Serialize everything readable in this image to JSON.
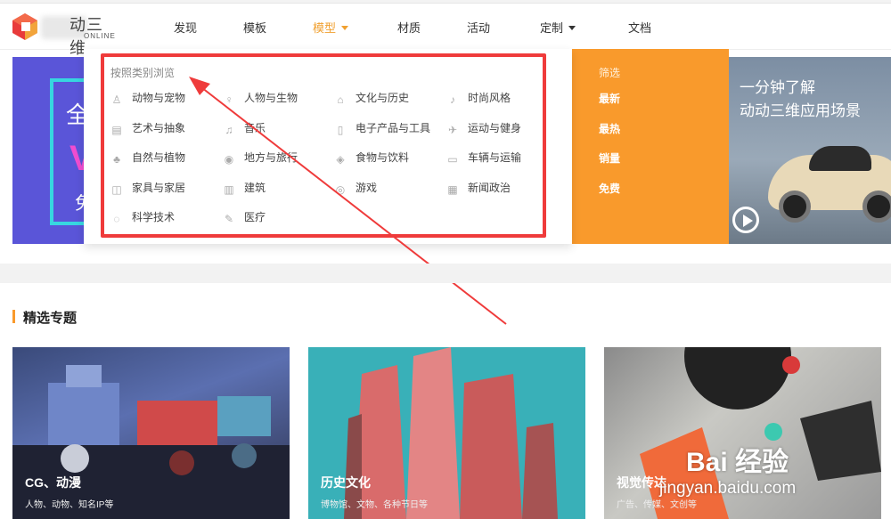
{
  "header": {
    "logo_text": "动三维",
    "logo_sub": "ONLINE",
    "nav": [
      {
        "label": "发现"
      },
      {
        "label": "模板"
      },
      {
        "label": "模型"
      },
      {
        "label": "材质"
      },
      {
        "label": "活动"
      },
      {
        "label": "定制"
      },
      {
        "label": "文档"
      }
    ],
    "accent_color": "#f0a030"
  },
  "hero_left": {
    "big": "全",
    "v": "V",
    "small": "免"
  },
  "dropdown": {
    "heading": "按照类别浏览",
    "categories": [
      {
        "label": "动物与宠物",
        "icon": "pet-icon"
      },
      {
        "label": "人物与生物",
        "icon": "person-icon"
      },
      {
        "label": "文化与历史",
        "icon": "temple-icon"
      },
      {
        "label": "时尚风格",
        "icon": "heel-icon"
      },
      {
        "label": "艺术与抽象",
        "icon": "art-icon"
      },
      {
        "label": "音乐",
        "icon": "music-icon"
      },
      {
        "label": "电子产品与工具",
        "icon": "device-icon"
      },
      {
        "label": "运动与健身",
        "icon": "sport-icon"
      },
      {
        "label": "自然与植物",
        "icon": "tree-icon"
      },
      {
        "label": "地方与旅行",
        "icon": "location-icon"
      },
      {
        "label": "食物与饮料",
        "icon": "food-icon"
      },
      {
        "label": "车辆与运输",
        "icon": "truck-icon"
      },
      {
        "label": "家具与家居",
        "icon": "sofa-icon"
      },
      {
        "label": "建筑",
        "icon": "building-icon"
      },
      {
        "label": "游戏",
        "icon": "gamepad-icon"
      },
      {
        "label": "新闻政治",
        "icon": "news-icon"
      },
      {
        "label": "科学技术",
        "icon": "science-icon"
      },
      {
        "label": "医疗",
        "icon": "syringe-icon"
      }
    ]
  },
  "filter": {
    "title": "筛选",
    "links": [
      {
        "label": "最新"
      },
      {
        "label": "最热"
      },
      {
        "label": "销量"
      },
      {
        "label": "免费"
      }
    ],
    "color": "#f99a2c"
  },
  "promo": {
    "line1": "一分钟了解",
    "line2": "动动三维应用场景"
  },
  "section": {
    "title": "精选专题"
  },
  "cards": [
    {
      "caption": "CG、动漫",
      "sub": "人物、动物、知名IP等"
    },
    {
      "caption": "历史文化",
      "sub": "博物馆、文物、各种节日等"
    },
    {
      "caption": "视觉传达",
      "sub": "广告、传媒、文创等"
    }
  ],
  "watermark": {
    "line1": "Bai 经验",
    "line2": "jingyan.baidu.com"
  },
  "annotation_color": "#ef3b3b"
}
